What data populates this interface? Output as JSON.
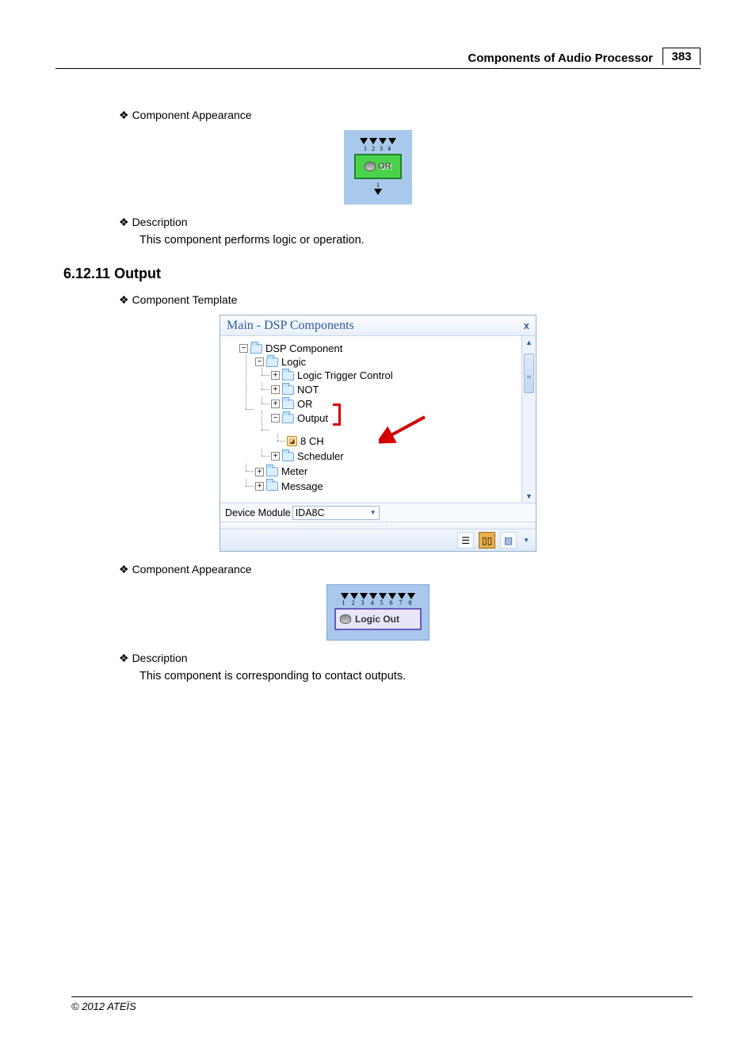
{
  "header": {
    "title": "Components of Audio Processor",
    "page": "383"
  },
  "s1": {
    "b1": "Component Appearance",
    "b2": "Description",
    "desc": "This component performs logic or operation.",
    "comp": {
      "label": "OR"
    }
  },
  "heading2": "6.12.11 Output",
  "s2": {
    "b1": "Component Template",
    "b2": "Component Appearance",
    "b3": "Description",
    "desc": "This component is corresponding to contact outputs.",
    "comp": {
      "label": "Logic Out"
    }
  },
  "panel": {
    "title": "Main - DSP Components",
    "close": "x",
    "tree": {
      "root": "DSP Component",
      "logic": "Logic",
      "items": {
        "ltc": "Logic Trigger Control",
        "not": "NOT",
        "or": "OR",
        "output": "Output",
        "ch8": "8 CH",
        "scheduler": "Scheduler"
      },
      "meter": "Meter",
      "message": "Message"
    },
    "deviceLabel": "Device Module",
    "deviceValue": "IDA8C",
    "drag": ". . . . ."
  },
  "footer": "© 2012 ATEÏS"
}
